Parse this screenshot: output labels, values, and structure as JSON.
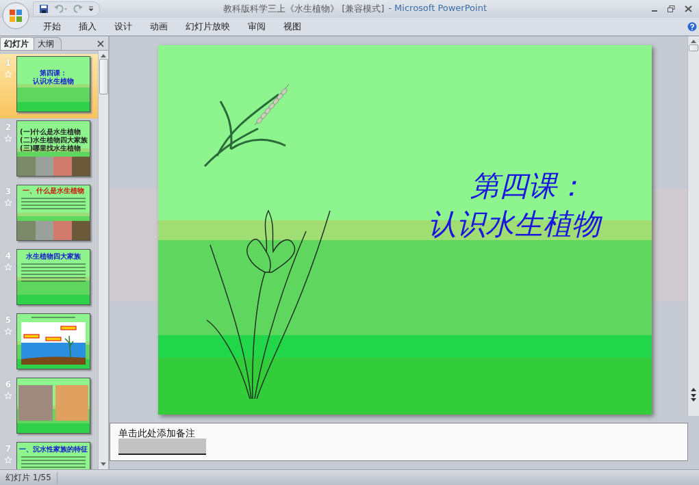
{
  "window": {
    "document_title": "教科版科学三上《水生植物》 [兼容模式]",
    "app_title": "- Microsoft PowerPoint"
  },
  "ribbon_tabs": [
    "开始",
    "插入",
    "设计",
    "动画",
    "幻灯片放映",
    "审阅",
    "视图"
  ],
  "pane_tabs": [
    {
      "label": "幻灯片",
      "selected": true
    },
    {
      "label": "大纲",
      "selected": false
    }
  ],
  "slides": [
    {
      "number": "1",
      "selected": true,
      "kind": "title",
      "lines": [
        "第四课：",
        "认识水生植物"
      ]
    },
    {
      "number": "2",
      "selected": false,
      "kind": "bullets",
      "lines": [
        "(一)什么是水生植物",
        "(二)水生植物四大家族",
        "(三)哪里找水生植物"
      ]
    },
    {
      "number": "3",
      "selected": false,
      "kind": "text_photos",
      "title": "一、什么是水生植物"
    },
    {
      "number": "4",
      "selected": false,
      "kind": "text",
      "title": "水生植物四大家族"
    },
    {
      "number": "5",
      "selected": false,
      "kind": "diagram"
    },
    {
      "number": "6",
      "selected": false,
      "kind": "photos"
    },
    {
      "number": "7",
      "selected": false,
      "kind": "text",
      "title": "一、沉水性家族的特征"
    }
  ],
  "main_slide": {
    "title_lines": [
      "第四课：",
      "认识水生植物"
    ]
  },
  "notes": {
    "hint": "单击此处添加备注"
  },
  "status_bar": {
    "slide_counter": "幻灯片 1/55"
  }
}
